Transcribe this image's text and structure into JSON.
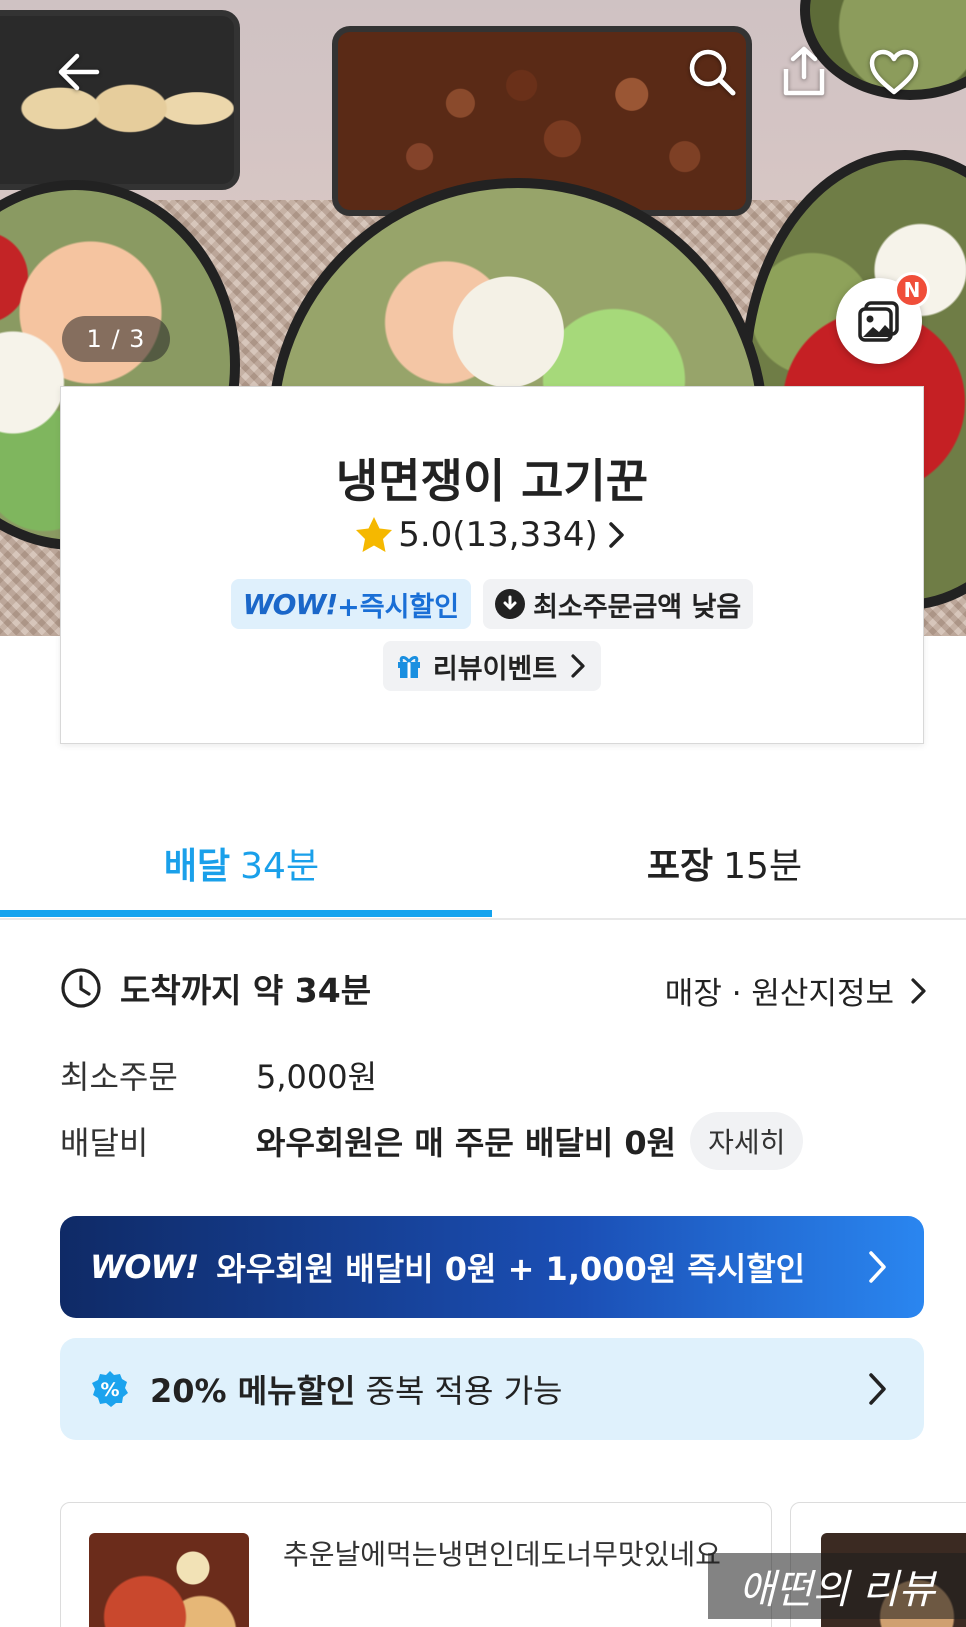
{
  "hero": {
    "image_counter": "1 / 3",
    "photo_badge": "N"
  },
  "store": {
    "name": "냉면쟁이 고기꾼",
    "rating": "5.0(13,334)",
    "wow_badge_logo": "WOW!",
    "wow_badge_text": "+즉시할인",
    "min_order_badge": "최소주문금액 낮음",
    "review_event": "리뷰이벤트"
  },
  "tabs": {
    "delivery_label": "배달",
    "delivery_time": "34분",
    "pickup_label": "포장",
    "pickup_time": "15분"
  },
  "info": {
    "arrival_text": "도착까지 약 34분",
    "store_info_link": "매장 · 원산지정보",
    "min_order_label": "최소주문",
    "min_order_value": "5,000원",
    "delivery_fee_label": "배달비",
    "delivery_fee_value": "와우회원은 매 주문 배달비 0원",
    "detail_button": "자세히"
  },
  "banners": {
    "wow_logo": "WOW!",
    "wow_text": "와우회원 배달비 0원 + 1,000원 즉시할인",
    "discount_bold": "20% 메뉴할인",
    "discount_rest": "중복 적용 가능"
  },
  "reviews": [
    {
      "text": "추운날에먹는냉면인데도너무맛있네요"
    }
  ],
  "watermark": "애떤의 리뷰",
  "colors": {
    "accent_blue": "#14a3ee",
    "wow_banner_start": "#0f2a66",
    "wow_banner_end": "#2a86f0",
    "light_blue_bg": "#dff1fc",
    "badge_red": "#f04e3a",
    "star": "#f5b800"
  },
  "icons": [
    "back-arrow-icon",
    "search-icon",
    "share-icon",
    "heart-icon",
    "photo-review-icon",
    "star-icon",
    "chevron-right-icon",
    "download-circle-icon",
    "gift-icon",
    "clock-icon",
    "percent-badge-icon"
  ]
}
